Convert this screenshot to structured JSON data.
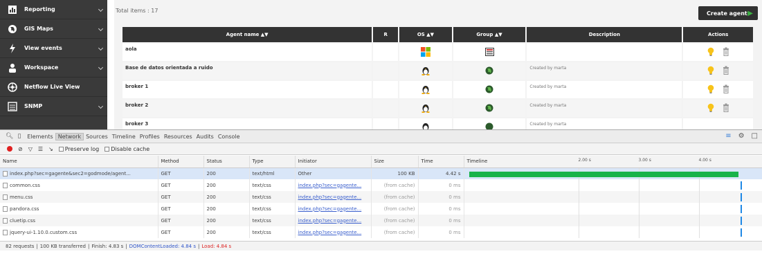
{
  "sidebar": {
    "items": [
      {
        "label": "Reporting",
        "icon": "reporting-icon"
      },
      {
        "label": "GIS Maps",
        "icon": "globe-icon"
      },
      {
        "label": "View events",
        "icon": "lightning-icon"
      },
      {
        "label": "Workspace",
        "icon": "user-icon"
      },
      {
        "label": "Netflow Live View",
        "icon": "network-icon"
      },
      {
        "label": "SNMP",
        "icon": "snmp-icon"
      }
    ]
  },
  "main": {
    "total_items": "Total items : 17",
    "create_button": "Create agent",
    "table": {
      "headers": [
        "Agent name ▲▼",
        "R",
        "OS ▲▼",
        "Group ▲▼",
        "Description",
        "Actions"
      ],
      "rows": [
        {
          "name": "aola",
          "os": "windows",
          "group": "server",
          "description": ""
        },
        {
          "name": "Base de datos orientada a ruido",
          "os": "linux",
          "group": "globe",
          "description": "Created by marta"
        },
        {
          "name": "broker 1",
          "os": "linux",
          "group": "globe",
          "description": "Created by marta"
        },
        {
          "name": "broker 2",
          "os": "linux",
          "group": "globe",
          "description": "Created by marta"
        },
        {
          "name": "broker 3",
          "os": "linux",
          "group": "globe",
          "description": "Created by marta"
        }
      ]
    }
  },
  "devtools": {
    "tabs": [
      "Elements",
      "Network",
      "Sources",
      "Timeline",
      "Profiles",
      "Resources",
      "Audits",
      "Console"
    ],
    "active_tab": "Network",
    "toolbar": {
      "preserve_log": "Preserve log",
      "disable_cache": "Disable cache"
    },
    "columns": [
      "Name",
      "Method",
      "Status",
      "Type",
      "Initiator",
      "Size",
      "Time",
      "Timeline"
    ],
    "timeline_marks": [
      "2.00 s",
      "3.00 s",
      "4.00 s"
    ],
    "requests": [
      {
        "name": "index.php?sec=gagente&sec2=godmode/agent...",
        "method": "GET",
        "status": "200",
        "type": "text/html",
        "initiator": "Other",
        "size": "100 KB",
        "time": "4.42 s",
        "bar": 0.995
      },
      {
        "name": "common.css",
        "method": "GET",
        "status": "200",
        "type": "text/css",
        "initiator": "index.php?sec=gagente...",
        "size": "(from cache)",
        "time": "0 ms",
        "bar": 0
      },
      {
        "name": "menu.css",
        "method": "GET",
        "status": "200",
        "type": "text/css",
        "initiator": "index.php?sec=gagente...",
        "size": "(from cache)",
        "time": "0 ms",
        "bar": 0
      },
      {
        "name": "pandora.css",
        "method": "GET",
        "status": "200",
        "type": "text/css",
        "initiator": "index.php?sec=gagente...",
        "size": "(from cache)",
        "time": "0 ms",
        "bar": 0
      },
      {
        "name": "cluetip.css",
        "method": "GET",
        "status": "200",
        "type": "text/css",
        "initiator": "index.php?sec=gagente...",
        "size": "(from cache)",
        "time": "0 ms",
        "bar": 0
      },
      {
        "name": "jquery-ui-1.10.0.custom.css",
        "method": "GET",
        "status": "200",
        "type": "text/css",
        "initiator": "index.php?sec=gagente...",
        "size": "(from cache)",
        "time": "0 ms",
        "bar": 0
      }
    ],
    "status": {
      "requests": "82 requests",
      "transferred": "100 KB transferred",
      "finish": "Finish: 4.83 s",
      "dcl": "DOMContentLoaded: 4.84 s",
      "load": "Load: 4.84 s",
      "sep": "|"
    }
  },
  "colors": {
    "sidebar_bg": "#3a3a3a",
    "header_bg": "#333333",
    "green": "#19b34a",
    "blue": "#1e88e5",
    "record": "#e02020"
  }
}
